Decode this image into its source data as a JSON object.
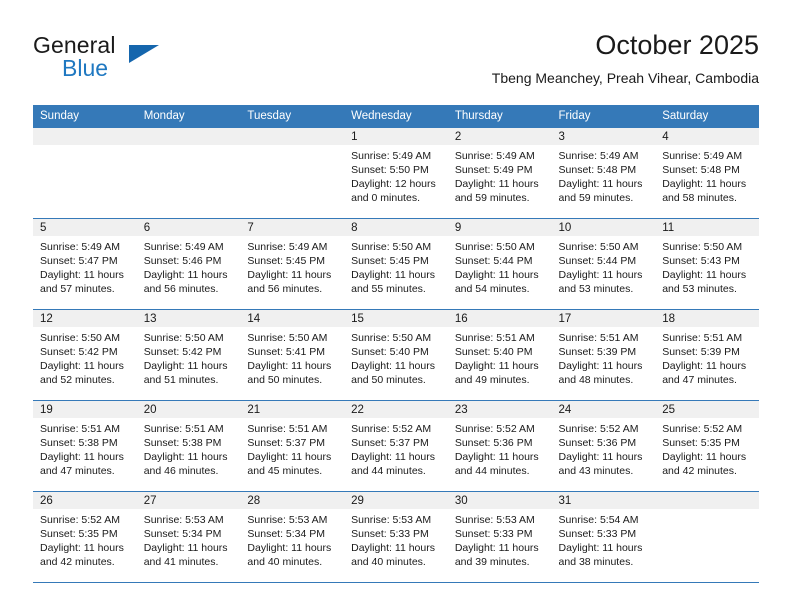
{
  "brand": {
    "line1": "General",
    "line2": "Blue",
    "triangle_icon": "brand-triangle-icon",
    "accent_color": "#1566ad",
    "blue_text_color": "#1f78c1"
  },
  "header": {
    "month_title": "October 2025",
    "location": "Tbeng Meanchey, Preah Vihear, Cambodia"
  },
  "calendar": {
    "header_bg": "#3579b8",
    "daynum_bg": "#f0f0f0",
    "weekday_headers": [
      "Sunday",
      "Monday",
      "Tuesday",
      "Wednesday",
      "Thursday",
      "Friday",
      "Saturday"
    ],
    "weeks": [
      [
        {
          "day": "",
          "empty": true
        },
        {
          "day": "",
          "empty": true
        },
        {
          "day": "",
          "empty": true
        },
        {
          "day": "1",
          "sunrise": "Sunrise: 5:49 AM",
          "sunset": "Sunset: 5:50 PM",
          "daylight": "Daylight: 12 hours and 0 minutes."
        },
        {
          "day": "2",
          "sunrise": "Sunrise: 5:49 AM",
          "sunset": "Sunset: 5:49 PM",
          "daylight": "Daylight: 11 hours and 59 minutes."
        },
        {
          "day": "3",
          "sunrise": "Sunrise: 5:49 AM",
          "sunset": "Sunset: 5:48 PM",
          "daylight": "Daylight: 11 hours and 59 minutes."
        },
        {
          "day": "4",
          "sunrise": "Sunrise: 5:49 AM",
          "sunset": "Sunset: 5:48 PM",
          "daylight": "Daylight: 11 hours and 58 minutes."
        }
      ],
      [
        {
          "day": "5",
          "sunrise": "Sunrise: 5:49 AM",
          "sunset": "Sunset: 5:47 PM",
          "daylight": "Daylight: 11 hours and 57 minutes."
        },
        {
          "day": "6",
          "sunrise": "Sunrise: 5:49 AM",
          "sunset": "Sunset: 5:46 PM",
          "daylight": "Daylight: 11 hours and 56 minutes."
        },
        {
          "day": "7",
          "sunrise": "Sunrise: 5:49 AM",
          "sunset": "Sunset: 5:45 PM",
          "daylight": "Daylight: 11 hours and 56 minutes."
        },
        {
          "day": "8",
          "sunrise": "Sunrise: 5:50 AM",
          "sunset": "Sunset: 5:45 PM",
          "daylight": "Daylight: 11 hours and 55 minutes."
        },
        {
          "day": "9",
          "sunrise": "Sunrise: 5:50 AM",
          "sunset": "Sunset: 5:44 PM",
          "daylight": "Daylight: 11 hours and 54 minutes."
        },
        {
          "day": "10",
          "sunrise": "Sunrise: 5:50 AM",
          "sunset": "Sunset: 5:44 PM",
          "daylight": "Daylight: 11 hours and 53 minutes."
        },
        {
          "day": "11",
          "sunrise": "Sunrise: 5:50 AM",
          "sunset": "Sunset: 5:43 PM",
          "daylight": "Daylight: 11 hours and 53 minutes."
        }
      ],
      [
        {
          "day": "12",
          "sunrise": "Sunrise: 5:50 AM",
          "sunset": "Sunset: 5:42 PM",
          "daylight": "Daylight: 11 hours and 52 minutes."
        },
        {
          "day": "13",
          "sunrise": "Sunrise: 5:50 AM",
          "sunset": "Sunset: 5:42 PM",
          "daylight": "Daylight: 11 hours and 51 minutes."
        },
        {
          "day": "14",
          "sunrise": "Sunrise: 5:50 AM",
          "sunset": "Sunset: 5:41 PM",
          "daylight": "Daylight: 11 hours and 50 minutes."
        },
        {
          "day": "15",
          "sunrise": "Sunrise: 5:50 AM",
          "sunset": "Sunset: 5:40 PM",
          "daylight": "Daylight: 11 hours and 50 minutes."
        },
        {
          "day": "16",
          "sunrise": "Sunrise: 5:51 AM",
          "sunset": "Sunset: 5:40 PM",
          "daylight": "Daylight: 11 hours and 49 minutes."
        },
        {
          "day": "17",
          "sunrise": "Sunrise: 5:51 AM",
          "sunset": "Sunset: 5:39 PM",
          "daylight": "Daylight: 11 hours and 48 minutes."
        },
        {
          "day": "18",
          "sunrise": "Sunrise: 5:51 AM",
          "sunset": "Sunset: 5:39 PM",
          "daylight": "Daylight: 11 hours and 47 minutes."
        }
      ],
      [
        {
          "day": "19",
          "sunrise": "Sunrise: 5:51 AM",
          "sunset": "Sunset: 5:38 PM",
          "daylight": "Daylight: 11 hours and 47 minutes."
        },
        {
          "day": "20",
          "sunrise": "Sunrise: 5:51 AM",
          "sunset": "Sunset: 5:38 PM",
          "daylight": "Daylight: 11 hours and 46 minutes."
        },
        {
          "day": "21",
          "sunrise": "Sunrise: 5:51 AM",
          "sunset": "Sunset: 5:37 PM",
          "daylight": "Daylight: 11 hours and 45 minutes."
        },
        {
          "day": "22",
          "sunrise": "Sunrise: 5:52 AM",
          "sunset": "Sunset: 5:37 PM",
          "daylight": "Daylight: 11 hours and 44 minutes."
        },
        {
          "day": "23",
          "sunrise": "Sunrise: 5:52 AM",
          "sunset": "Sunset: 5:36 PM",
          "daylight": "Daylight: 11 hours and 44 minutes."
        },
        {
          "day": "24",
          "sunrise": "Sunrise: 5:52 AM",
          "sunset": "Sunset: 5:36 PM",
          "daylight": "Daylight: 11 hours and 43 minutes."
        },
        {
          "day": "25",
          "sunrise": "Sunrise: 5:52 AM",
          "sunset": "Sunset: 5:35 PM",
          "daylight": "Daylight: 11 hours and 42 minutes."
        }
      ],
      [
        {
          "day": "26",
          "sunrise": "Sunrise: 5:52 AM",
          "sunset": "Sunset: 5:35 PM",
          "daylight": "Daylight: 11 hours and 42 minutes."
        },
        {
          "day": "27",
          "sunrise": "Sunrise: 5:53 AM",
          "sunset": "Sunset: 5:34 PM",
          "daylight": "Daylight: 11 hours and 41 minutes."
        },
        {
          "day": "28",
          "sunrise": "Sunrise: 5:53 AM",
          "sunset": "Sunset: 5:34 PM",
          "daylight": "Daylight: 11 hours and 40 minutes."
        },
        {
          "day": "29",
          "sunrise": "Sunrise: 5:53 AM",
          "sunset": "Sunset: 5:33 PM",
          "daylight": "Daylight: 11 hours and 40 minutes."
        },
        {
          "day": "30",
          "sunrise": "Sunrise: 5:53 AM",
          "sunset": "Sunset: 5:33 PM",
          "daylight": "Daylight: 11 hours and 39 minutes."
        },
        {
          "day": "31",
          "sunrise": "Sunrise: 5:54 AM",
          "sunset": "Sunset: 5:33 PM",
          "daylight": "Daylight: 11 hours and 38 minutes."
        },
        {
          "day": "",
          "empty": true
        }
      ]
    ]
  }
}
